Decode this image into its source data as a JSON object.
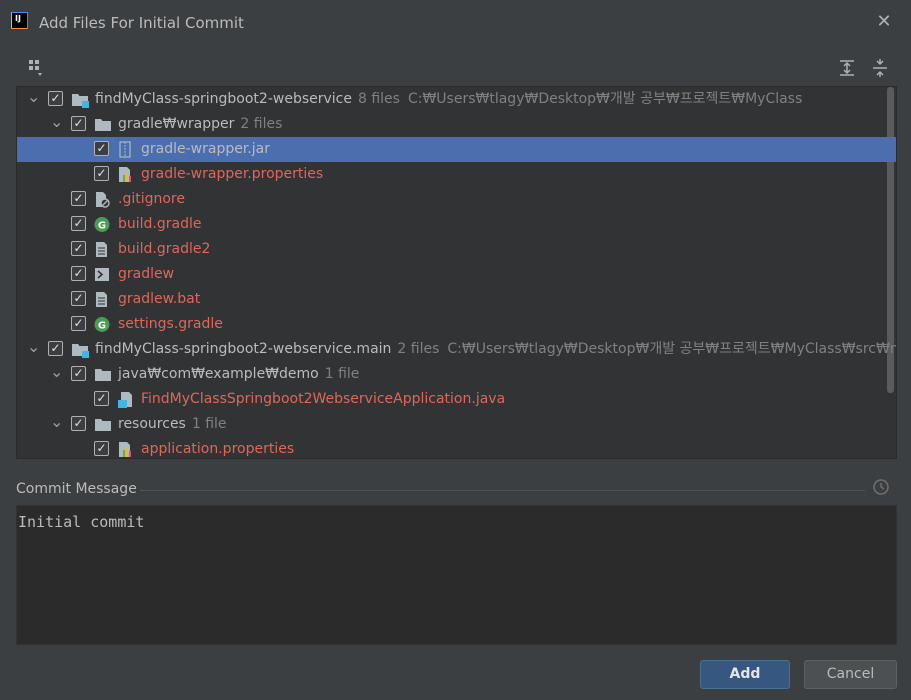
{
  "window": {
    "title": "Add Files For Initial Commit"
  },
  "toolbar": {
    "group_icon": "group-by-icon",
    "expand_icon": "expand-all-icon",
    "collapse_icon": "collapse-all-icon"
  },
  "tree": [
    {
      "level": 0,
      "expanded": true,
      "checked": true,
      "icon": "module-icon",
      "label": "findMyClass-springboot2-webservice",
      "count": "8 files",
      "path": "C:₩Users₩tlagy₩Desktop₩개발 공부₩프로젝트₩MyClass",
      "color": "white"
    },
    {
      "level": 1,
      "expanded": true,
      "checked": true,
      "icon": "folder-icon",
      "label": "gradle₩wrapper",
      "count": "2 files",
      "path": "",
      "color": "white"
    },
    {
      "level": 2,
      "expanded": null,
      "checked": true,
      "icon": "jar-icon",
      "label": "gradle-wrapper.jar",
      "count": "",
      "path": "",
      "color": "white",
      "selected": true
    },
    {
      "level": 2,
      "expanded": null,
      "checked": true,
      "icon": "properties-icon",
      "label": "gradle-wrapper.properties",
      "count": "",
      "path": "",
      "color": "red"
    },
    {
      "level": 1,
      "expanded": null,
      "checked": true,
      "icon": "ignore-file-icon",
      "label": ".gitignore",
      "count": "",
      "path": "",
      "color": "red"
    },
    {
      "level": 1,
      "expanded": null,
      "checked": true,
      "icon": "gradle-icon",
      "label": "build.gradle",
      "count": "",
      "path": "",
      "color": "red"
    },
    {
      "level": 1,
      "expanded": null,
      "checked": true,
      "icon": "text-file-icon",
      "label": "build.gradle2",
      "count": "",
      "path": "",
      "color": "red"
    },
    {
      "level": 1,
      "expanded": null,
      "checked": true,
      "icon": "shell-icon",
      "label": "gradlew",
      "count": "",
      "path": "",
      "color": "red"
    },
    {
      "level": 1,
      "expanded": null,
      "checked": true,
      "icon": "text-file-icon",
      "label": "gradlew.bat",
      "count": "",
      "path": "",
      "color": "red"
    },
    {
      "level": 1,
      "expanded": null,
      "checked": true,
      "icon": "gradle-icon",
      "label": "settings.gradle",
      "count": "",
      "path": "",
      "color": "red"
    },
    {
      "level": 0,
      "expanded": true,
      "checked": true,
      "icon": "module-icon",
      "label": "findMyClass-springboot2-webservice.main",
      "count": "2 files",
      "path": "C:₩Users₩tlagy₩Desktop₩개발 공부₩프로젝트₩MyClass₩src₩ma",
      "color": "white"
    },
    {
      "level": 1,
      "expanded": true,
      "checked": true,
      "icon": "folder-icon",
      "label": "java₩com₩example₩demo",
      "count": "1 file",
      "path": "",
      "color": "white"
    },
    {
      "level": 2,
      "expanded": null,
      "checked": true,
      "icon": "java-class-icon",
      "label": "FindMyClassSpringboot2WebserviceApplication.java",
      "count": "",
      "path": "",
      "color": "red"
    },
    {
      "level": 1,
      "expanded": true,
      "checked": true,
      "icon": "folder-icon",
      "label": "resources",
      "count": "1 file",
      "path": "",
      "color": "white"
    },
    {
      "level": 2,
      "expanded": null,
      "checked": true,
      "icon": "properties-icon",
      "label": "application.properties",
      "count": "",
      "path": "",
      "color": "red"
    }
  ],
  "commit": {
    "label": "Commit Message",
    "message": "Initial commit",
    "history_icon": "history-icon"
  },
  "buttons": {
    "add": "Add",
    "cancel": "Cancel"
  },
  "colors": {
    "accent": "#4b6eaf",
    "untracked": "#e0665a",
    "add_button": "#365880"
  }
}
